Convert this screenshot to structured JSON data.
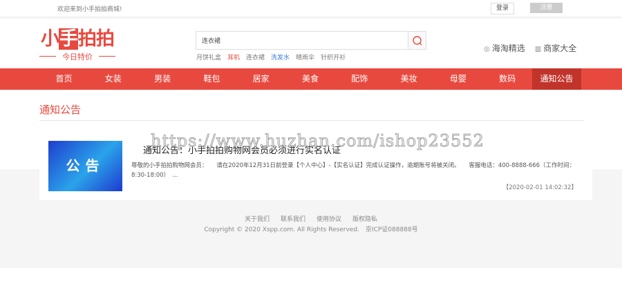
{
  "topbar": {
    "welcome": "欢迎来到小手拍拍商城!",
    "login": "登录",
    "register": "注册"
  },
  "logo": {
    "brand_pre": "小",
    "brand_hand": "手",
    "brand_post": "拍拍",
    "slogan": "今日特价"
  },
  "search": {
    "value": "连衣裙"
  },
  "hotwords": [
    {
      "label": "月饼礼盒",
      "color": "#777777"
    },
    {
      "label": "耳机",
      "color": "#e8493f"
    },
    {
      "label": "连衣裙",
      "color": "#777777"
    },
    {
      "label": "洗发水",
      "color": "#3a7be0"
    },
    {
      "label": "晴雨伞",
      "color": "#777777"
    },
    {
      "label": "针织开衫",
      "color": "#777777"
    }
  ],
  "header_links": [
    {
      "label": "海淘精选",
      "icon": "globe-icon"
    },
    {
      "label": "商家大全",
      "icon": "store-icon"
    }
  ],
  "nav": [
    "首页",
    "女装",
    "男装",
    "鞋包",
    "居家",
    "美食",
    "配饰",
    "美妆",
    "母婴",
    "数码",
    "通知公告"
  ],
  "page_title": "通知公告",
  "notice": {
    "thumb_text": "公告",
    "title": "通知公告：小手拍拍购物网会员必须进行实名认证",
    "body": "尊敬的小手拍拍购物网会员：　　请在2020年12月31日前登录【个人中心】-【实名认证】完成认证操作，逾期账号将被关闭。　　客服电话：400-8888-666（工作时间：8:30-18:00）　...",
    "date": "【2020-02-01 14:02:32】"
  },
  "watermark": "https://www.huzhan.com/ishop23552",
  "footer": {
    "links": [
      "关于我们",
      "联系我们",
      "使用协议",
      "版权隐私"
    ],
    "copyright": "Copyright © 2020 Xspp.com. All Rights Reserved.　京ICP证088888号"
  }
}
